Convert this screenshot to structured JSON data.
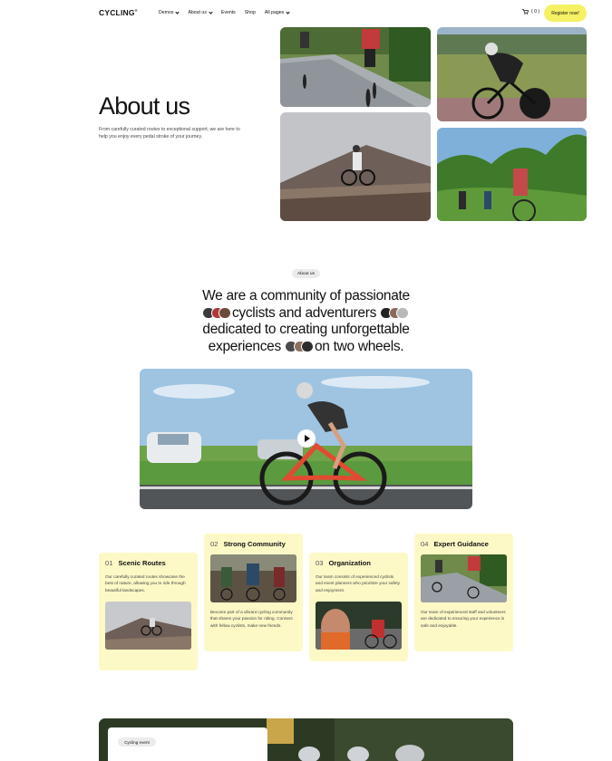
{
  "header": {
    "logo": "CYCLING",
    "logo_mark": "®",
    "nav": [
      {
        "label": "Demos",
        "has_dropdown": true
      },
      {
        "label": "About us",
        "has_dropdown": true
      },
      {
        "label": "Events",
        "has_dropdown": false
      },
      {
        "label": "Shop",
        "has_dropdown": false
      },
      {
        "label": "All pages",
        "has_dropdown": true
      }
    ],
    "cart_icon": "cart-icon",
    "cart_count": "( 0 )",
    "cta_label": "Register now!",
    "cta_color": "#f5f163"
  },
  "hero": {
    "title": "About us",
    "description": "From carefully curated routes to exceptional support, we are here to help you enjoy every pedal stroke of your journey."
  },
  "about": {
    "badge": "About us",
    "mission_part1": "We are a community of passionate",
    "mission_part2": "cyclists and adventurers",
    "mission_part3": "dedicated to creating unforgettable",
    "mission_part4": "experiences",
    "mission_part5": "on two wheels."
  },
  "video": {
    "play_icon": "play-icon"
  },
  "features": [
    {
      "num": "01",
      "title": "Scenic Routes",
      "text": "Our carefully curated routes showcase the best of nature, allowing you to ride through beautiful landscapes."
    },
    {
      "num": "02",
      "title": "Strong Community",
      "text": "Become part of a vibrant cycling community that shares your passion for riding. Connect with fellow cyclists, make new friends."
    },
    {
      "num": "03",
      "title": "Organization",
      "text": "Our team consists of experienced cyclists and event planners who prioritize your safety and enjoyment."
    },
    {
      "num": "04",
      "title": "Expert Guidance",
      "text": "Our team of experienced staff and volunteers are dedicated to ensuring your experience is safe and enjoyable."
    }
  ],
  "feature_card_color": "#fcf9c7",
  "bottom": {
    "badge": "Cycling event"
  }
}
